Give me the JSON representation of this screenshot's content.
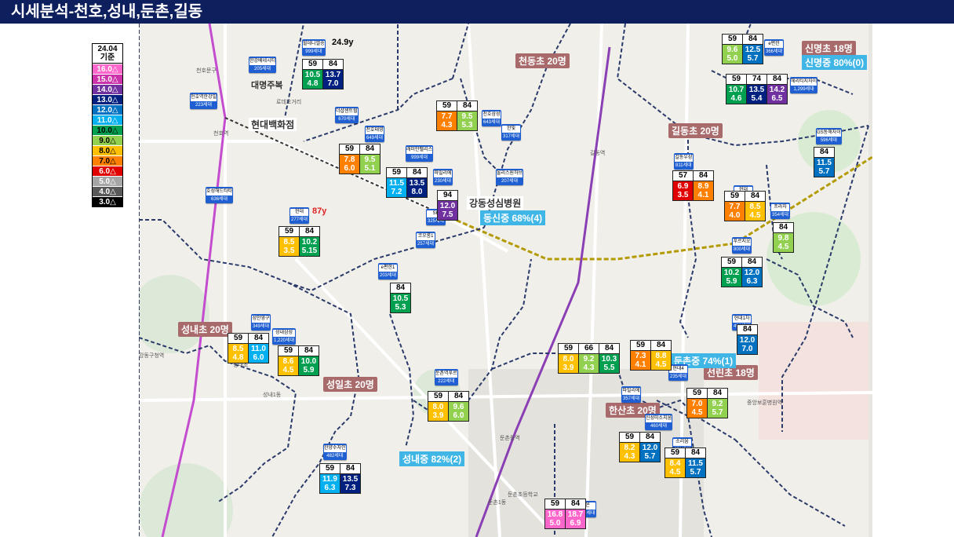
{
  "title": "시세분석-천호,성내,둔촌,길동",
  "legend": {
    "header_line1": "24.04",
    "header_line2": "기준",
    "items": [
      {
        "label": "16.0△",
        "color": "#ff66cc"
      },
      {
        "label": "15.0△",
        "color": "#cc33aa"
      },
      {
        "label": "14.0△",
        "color": "#7030a0"
      },
      {
        "label": "13.0△",
        "color": "#002080"
      },
      {
        "label": "12.0△",
        "color": "#0070c0"
      },
      {
        "label": "11.0△",
        "color": "#00b0f0"
      },
      {
        "label": "10.0△",
        "color": "#00a050"
      },
      {
        "label": "9.0△",
        "color": "#92d050"
      },
      {
        "label": "8.0△",
        "color": "#ffc000"
      },
      {
        "label": "7.0△",
        "color": "#ff7f00"
      },
      {
        "label": "6.0△",
        "color": "#e00000"
      },
      {
        "label": "5.0△",
        "color": "#a6a6a6"
      },
      {
        "label": "4.0△",
        "color": "#595959"
      },
      {
        "label": "3.0△",
        "color": "#000000"
      }
    ]
  },
  "landmarks": {
    "hyundai": "현대백화점",
    "daemyung": "대명주복",
    "hospital": "강동성심병원"
  },
  "places": [
    "천호역",
    "강동구청역",
    "성내1동",
    "둔촌1동",
    "둔촌동역",
    "길동역",
    "강동역",
    "중앙보훈병원역",
    "천호문구",
    "로데오거리",
    "성내초",
    "둔촌초등학교"
  ],
  "schools": [
    {
      "label": "천동초 20명"
    },
    {
      "label": "신명초 18명"
    },
    {
      "label": "길동초 20명"
    },
    {
      "label": "성내초 20명"
    },
    {
      "label": "성일초 20명"
    },
    {
      "label": "한산초 20명"
    },
    {
      "label": "선린초 18명"
    }
  ],
  "middle": [
    {
      "label": "신명중 80%(0)"
    },
    {
      "label": "동신중 68%(4)"
    },
    {
      "label": "둔촌중 74%(1)"
    },
    {
      "label": "성내중 82%(2)"
    }
  ],
  "apts": [
    {
      "name": "힐데니엘송",
      "units": "999세대"
    },
    {
      "name": "한강베네시티",
      "units": "205세대"
    },
    {
      "name": "천호역한강밀",
      "units": "223세대"
    },
    {
      "name": "더샵센트럴",
      "units": "670세대"
    },
    {
      "name": "천호태영",
      "units": "649세대"
    },
    {
      "name": "래미안팰리스",
      "units": "999세대"
    },
    {
      "name": "천호삼성",
      "units": "643세대"
    },
    {
      "name": "한빛",
      "units": "317세대"
    },
    {
      "name": "파밀리에",
      "units": "230세대"
    },
    {
      "name": "올리스원하브",
      "units": "207세대"
    },
    {
      "name": "SK",
      "units": "325세대"
    },
    {
      "name": "코오롱1",
      "units": "257세대"
    },
    {
      "name": "호성해드타타",
      "units": "636세대"
    },
    {
      "name": "현대",
      "units": "277세대"
    },
    {
      "name": "e편한1",
      "units": "203세대"
    },
    {
      "name": "성안영구",
      "units": "349세대"
    },
    {
      "name": "성내삼성",
      "units": "1,220세대"
    },
    {
      "name": "둔촌역푸르",
      "units": "222세대"
    },
    {
      "name": "한양수자인",
      "units": "482세대"
    },
    {
      "name": "e편한",
      "units": "366세대"
    },
    {
      "name": "헤리티지자이",
      "units": "1,299세대"
    },
    {
      "name": "길동우성",
      "units": "811세대"
    },
    {
      "name": "현대",
      "units": "264세대"
    },
    {
      "name": "프라자",
      "units": "354세대"
    },
    {
      "name": "푸르지오",
      "units": "800세대"
    },
    {
      "name": "현대1차",
      "units": "498세대"
    },
    {
      "name": "현대4",
      "units": "235세대"
    },
    {
      "name": "파밀리에",
      "units": "357세대"
    },
    {
      "name": "신성미소지움",
      "units": "460세대"
    },
    {
      "name": "소리움",
      "units": "278세대"
    },
    {
      "name": "포레온",
      "units": "12,032세대"
    },
    {
      "name": "GS동해자이",
      "units": "596세대"
    }
  ],
  "age_labels": {
    "a1": "24.9y",
    "a2": "87y"
  },
  "price_grids": [
    {
      "h": [
        "59",
        "84"
      ],
      "v": [
        [
          "10.5",
          "4.8"
        ],
        [
          "13.7",
          "7.0"
        ]
      ],
      "c": [
        "#00a050",
        "#002080"
      ]
    },
    {
      "h": [
        "59",
        "84"
      ],
      "v": [
        [
          "7.7",
          "4.3"
        ],
        [
          "9.5",
          "5.3"
        ]
      ],
      "c": [
        "#ff7f00",
        "#92d050"
      ]
    },
    {
      "h": [
        "59",
        "84"
      ],
      "v": [
        [
          "7.8",
          "6.0"
        ],
        [
          "9.5",
          "5.1"
        ]
      ],
      "c": [
        "#ff7f00",
        "#92d050"
      ]
    },
    {
      "h": [
        "59",
        "84"
      ],
      "v": [
        [
          "11.5",
          "7.2"
        ],
        [
          "13.5",
          "8.0"
        ]
      ],
      "c": [
        "#00b0f0",
        "#002080"
      ]
    },
    {
      "h": [
        "94"
      ],
      "v": [
        [
          "12.0",
          "7.5"
        ]
      ],
      "c": [
        "#7030a0"
      ]
    },
    {
      "h": [
        "59",
        "84"
      ],
      "v": [
        [
          "8.5",
          "3.5"
        ],
        [
          "10.2",
          "5.15"
        ]
      ],
      "c": [
        "#ffc000",
        "#00a050"
      ]
    },
    {
      "h": [
        "84"
      ],
      "v": [
        [
          "10.5",
          "5.3"
        ]
      ],
      "c": [
        "#00a050"
      ]
    },
    {
      "h": [
        "59",
        "84"
      ],
      "v": [
        [
          "8.5",
          "4.8"
        ],
        [
          "11.0",
          "6.0"
        ]
      ],
      "c": [
        "#ffc000",
        "#00b0f0"
      ]
    },
    {
      "h": [
        "59",
        "84"
      ],
      "v": [
        [
          "8.6",
          "4.5"
        ],
        [
          "10.0",
          "5.9"
        ]
      ],
      "c": [
        "#ffc000",
        "#00a050"
      ]
    },
    {
      "h": [
        "59",
        "84"
      ],
      "v": [
        [
          "8.0",
          "3.9"
        ],
        [
          "9.6",
          "6.0"
        ]
      ],
      "c": [
        "#ffc000",
        "#92d050"
      ]
    },
    {
      "h": [
        "59",
        "84"
      ],
      "v": [
        [
          "11.9",
          "6.3"
        ],
        [
          "13.5",
          "7.3"
        ]
      ],
      "c": [
        "#00b0f0",
        "#002080"
      ]
    },
    {
      "h": [
        "59",
        "84"
      ],
      "v": [
        [
          "9.6",
          "5.0"
        ],
        [
          "12.5",
          "5.7"
        ]
      ],
      "c": [
        "#92d050",
        "#0070c0"
      ]
    },
    {
      "h": [
        "59",
        "74",
        "84"
      ],
      "v": [
        [
          "10.7",
          "4.6"
        ],
        [
          "13.5",
          "5.4"
        ],
        [
          "14.2",
          "6.5"
        ]
      ],
      "c": [
        "#00a050",
        "#002080",
        "#7030a0"
      ]
    },
    {
      "h": [
        "84"
      ],
      "v": [
        [
          "11.5",
          "5.7"
        ]
      ],
      "c": [
        "#0070c0"
      ]
    },
    {
      "h": [
        "57",
        "84"
      ],
      "v": [
        [
          "6.9",
          "3.5"
        ],
        [
          "8.9",
          "4.1"
        ]
      ],
      "c": [
        "#e00000",
        "#ff7f00"
      ]
    },
    {
      "h": [
        "59",
        "84"
      ],
      "v": [
        [
          "7.7",
          "4.0"
        ],
        [
          "8.5",
          "4.5"
        ]
      ],
      "c": [
        "#ff7f00",
        "#ffc000"
      ]
    },
    {
      "h": [
        "84"
      ],
      "v": [
        [
          "9.8",
          "4.5"
        ]
      ],
      "c": [
        "#92d050"
      ]
    },
    {
      "h": [
        "59",
        "84"
      ],
      "v": [
        [
          "10.2",
          "5.9"
        ],
        [
          "12.0",
          "6.3"
        ]
      ],
      "c": [
        "#00a050",
        "#0070c0"
      ]
    },
    {
      "h": [
        "84"
      ],
      "v": [
        [
          "12.0",
          "7.0"
        ]
      ],
      "c": [
        "#0070c0"
      ]
    },
    {
      "h": [
        "59",
        "84"
      ],
      "v": [
        [
          "7.3",
          "4.1"
        ],
        [
          "8.8",
          "4.5"
        ]
      ],
      "c": [
        "#ff7f00",
        "#ffc000"
      ]
    },
    {
      "h": [
        "59",
        "66",
        "84"
      ],
      "v": [
        [
          "8.0",
          "3.9"
        ],
        [
          "9.2",
          "4.3"
        ],
        [
          "10.3",
          "5.5"
        ]
      ],
      "c": [
        "#ffc000",
        "#92d050",
        "#00a050"
      ]
    },
    {
      "h": [
        "59",
        "84"
      ],
      "v": [
        [
          "7.0",
          "4.5"
        ],
        [
          "9.2",
          "5.7"
        ]
      ],
      "c": [
        "#ff7f00",
        "#92d050"
      ]
    },
    {
      "h": [
        "59",
        "84"
      ],
      "v": [
        [
          "8.2",
          "4.3"
        ],
        [
          "12.0",
          "5.7"
        ]
      ],
      "c": [
        "#ffc000",
        "#0070c0"
      ]
    },
    {
      "h": [
        "59",
        "84"
      ],
      "v": [
        [
          "8.4",
          "4.5"
        ],
        [
          "11.5",
          "5.7"
        ]
      ],
      "c": [
        "#ffc000",
        "#0070c0"
      ]
    },
    {
      "h": [
        "59",
        "84"
      ],
      "v": [
        [
          "16.8",
          "5.0"
        ],
        [
          "18.7",
          "6.9"
        ]
      ],
      "c": [
        "#ff66cc",
        "#ff66cc"
      ]
    }
  ]
}
